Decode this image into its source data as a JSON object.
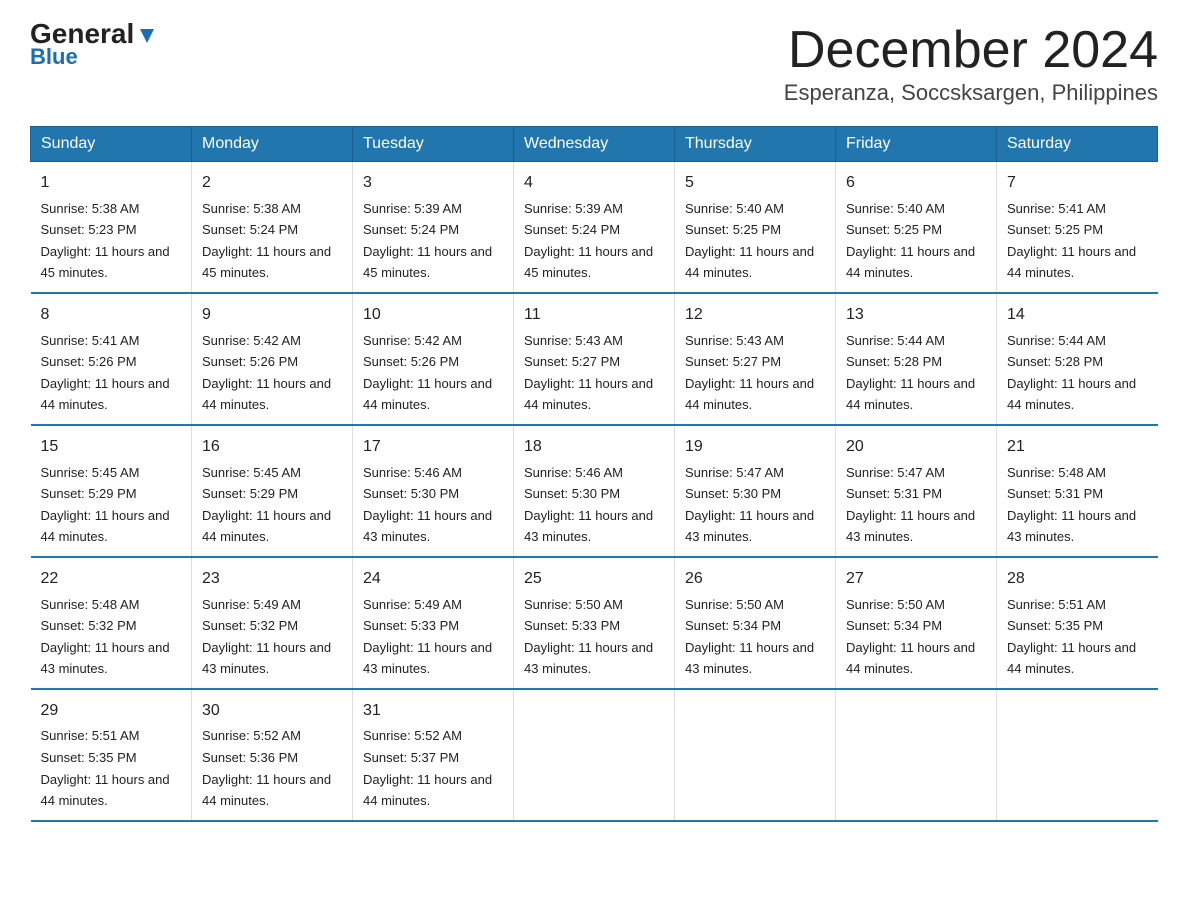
{
  "header": {
    "logo_general": "General",
    "logo_blue": "Blue",
    "month_title": "December 2024",
    "location": "Esperanza, Soccsksargen, Philippines"
  },
  "days_of_week": [
    "Sunday",
    "Monday",
    "Tuesday",
    "Wednesday",
    "Thursday",
    "Friday",
    "Saturday"
  ],
  "weeks": [
    [
      {
        "day": 1,
        "sunrise": "5:38 AM",
        "sunset": "5:23 PM",
        "daylight": "11 hours and 45 minutes."
      },
      {
        "day": 2,
        "sunrise": "5:38 AM",
        "sunset": "5:24 PM",
        "daylight": "11 hours and 45 minutes."
      },
      {
        "day": 3,
        "sunrise": "5:39 AM",
        "sunset": "5:24 PM",
        "daylight": "11 hours and 45 minutes."
      },
      {
        "day": 4,
        "sunrise": "5:39 AM",
        "sunset": "5:24 PM",
        "daylight": "11 hours and 45 minutes."
      },
      {
        "day": 5,
        "sunrise": "5:40 AM",
        "sunset": "5:25 PM",
        "daylight": "11 hours and 44 minutes."
      },
      {
        "day": 6,
        "sunrise": "5:40 AM",
        "sunset": "5:25 PM",
        "daylight": "11 hours and 44 minutes."
      },
      {
        "day": 7,
        "sunrise": "5:41 AM",
        "sunset": "5:25 PM",
        "daylight": "11 hours and 44 minutes."
      }
    ],
    [
      {
        "day": 8,
        "sunrise": "5:41 AM",
        "sunset": "5:26 PM",
        "daylight": "11 hours and 44 minutes."
      },
      {
        "day": 9,
        "sunrise": "5:42 AM",
        "sunset": "5:26 PM",
        "daylight": "11 hours and 44 minutes."
      },
      {
        "day": 10,
        "sunrise": "5:42 AM",
        "sunset": "5:26 PM",
        "daylight": "11 hours and 44 minutes."
      },
      {
        "day": 11,
        "sunrise": "5:43 AM",
        "sunset": "5:27 PM",
        "daylight": "11 hours and 44 minutes."
      },
      {
        "day": 12,
        "sunrise": "5:43 AM",
        "sunset": "5:27 PM",
        "daylight": "11 hours and 44 minutes."
      },
      {
        "day": 13,
        "sunrise": "5:44 AM",
        "sunset": "5:28 PM",
        "daylight": "11 hours and 44 minutes."
      },
      {
        "day": 14,
        "sunrise": "5:44 AM",
        "sunset": "5:28 PM",
        "daylight": "11 hours and 44 minutes."
      }
    ],
    [
      {
        "day": 15,
        "sunrise": "5:45 AM",
        "sunset": "5:29 PM",
        "daylight": "11 hours and 44 minutes."
      },
      {
        "day": 16,
        "sunrise": "5:45 AM",
        "sunset": "5:29 PM",
        "daylight": "11 hours and 44 minutes."
      },
      {
        "day": 17,
        "sunrise": "5:46 AM",
        "sunset": "5:30 PM",
        "daylight": "11 hours and 43 minutes."
      },
      {
        "day": 18,
        "sunrise": "5:46 AM",
        "sunset": "5:30 PM",
        "daylight": "11 hours and 43 minutes."
      },
      {
        "day": 19,
        "sunrise": "5:47 AM",
        "sunset": "5:30 PM",
        "daylight": "11 hours and 43 minutes."
      },
      {
        "day": 20,
        "sunrise": "5:47 AM",
        "sunset": "5:31 PM",
        "daylight": "11 hours and 43 minutes."
      },
      {
        "day": 21,
        "sunrise": "5:48 AM",
        "sunset": "5:31 PM",
        "daylight": "11 hours and 43 minutes."
      }
    ],
    [
      {
        "day": 22,
        "sunrise": "5:48 AM",
        "sunset": "5:32 PM",
        "daylight": "11 hours and 43 minutes."
      },
      {
        "day": 23,
        "sunrise": "5:49 AM",
        "sunset": "5:32 PM",
        "daylight": "11 hours and 43 minutes."
      },
      {
        "day": 24,
        "sunrise": "5:49 AM",
        "sunset": "5:33 PM",
        "daylight": "11 hours and 43 minutes."
      },
      {
        "day": 25,
        "sunrise": "5:50 AM",
        "sunset": "5:33 PM",
        "daylight": "11 hours and 43 minutes."
      },
      {
        "day": 26,
        "sunrise": "5:50 AM",
        "sunset": "5:34 PM",
        "daylight": "11 hours and 43 minutes."
      },
      {
        "day": 27,
        "sunrise": "5:50 AM",
        "sunset": "5:34 PM",
        "daylight": "11 hours and 44 minutes."
      },
      {
        "day": 28,
        "sunrise": "5:51 AM",
        "sunset": "5:35 PM",
        "daylight": "11 hours and 44 minutes."
      }
    ],
    [
      {
        "day": 29,
        "sunrise": "5:51 AM",
        "sunset": "5:35 PM",
        "daylight": "11 hours and 44 minutes."
      },
      {
        "day": 30,
        "sunrise": "5:52 AM",
        "sunset": "5:36 PM",
        "daylight": "11 hours and 44 minutes."
      },
      {
        "day": 31,
        "sunrise": "5:52 AM",
        "sunset": "5:37 PM",
        "daylight": "11 hours and 44 minutes."
      },
      null,
      null,
      null,
      null
    ]
  ],
  "labels": {
    "sunrise": "Sunrise:",
    "sunset": "Sunset:",
    "daylight": "Daylight:"
  }
}
